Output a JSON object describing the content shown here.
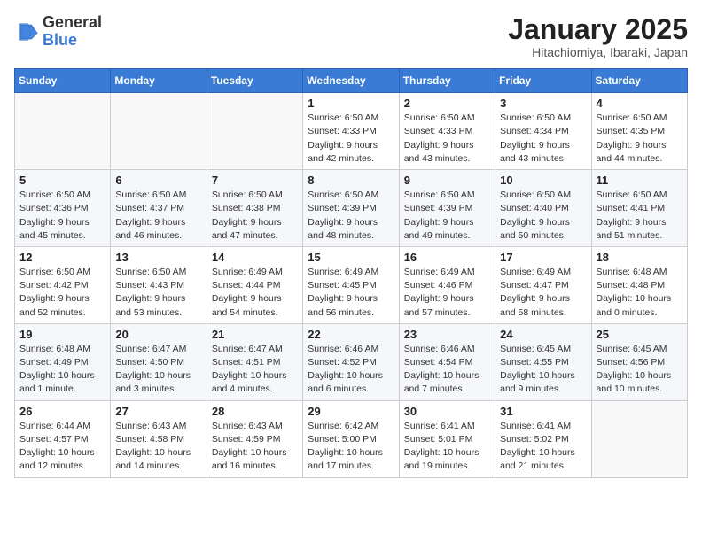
{
  "header": {
    "logo_general": "General",
    "logo_blue": "Blue",
    "month_year": "January 2025",
    "location": "Hitachiomiya, Ibaraki, Japan"
  },
  "days_of_week": [
    "Sunday",
    "Monday",
    "Tuesday",
    "Wednesday",
    "Thursday",
    "Friday",
    "Saturday"
  ],
  "weeks": [
    [
      {
        "day": "",
        "info": ""
      },
      {
        "day": "",
        "info": ""
      },
      {
        "day": "",
        "info": ""
      },
      {
        "day": "1",
        "info": "Sunrise: 6:50 AM\nSunset: 4:33 PM\nDaylight: 9 hours\nand 42 minutes."
      },
      {
        "day": "2",
        "info": "Sunrise: 6:50 AM\nSunset: 4:33 PM\nDaylight: 9 hours\nand 43 minutes."
      },
      {
        "day": "3",
        "info": "Sunrise: 6:50 AM\nSunset: 4:34 PM\nDaylight: 9 hours\nand 43 minutes."
      },
      {
        "day": "4",
        "info": "Sunrise: 6:50 AM\nSunset: 4:35 PM\nDaylight: 9 hours\nand 44 minutes."
      }
    ],
    [
      {
        "day": "5",
        "info": "Sunrise: 6:50 AM\nSunset: 4:36 PM\nDaylight: 9 hours\nand 45 minutes."
      },
      {
        "day": "6",
        "info": "Sunrise: 6:50 AM\nSunset: 4:37 PM\nDaylight: 9 hours\nand 46 minutes."
      },
      {
        "day": "7",
        "info": "Sunrise: 6:50 AM\nSunset: 4:38 PM\nDaylight: 9 hours\nand 47 minutes."
      },
      {
        "day": "8",
        "info": "Sunrise: 6:50 AM\nSunset: 4:39 PM\nDaylight: 9 hours\nand 48 minutes."
      },
      {
        "day": "9",
        "info": "Sunrise: 6:50 AM\nSunset: 4:39 PM\nDaylight: 9 hours\nand 49 minutes."
      },
      {
        "day": "10",
        "info": "Sunrise: 6:50 AM\nSunset: 4:40 PM\nDaylight: 9 hours\nand 50 minutes."
      },
      {
        "day": "11",
        "info": "Sunrise: 6:50 AM\nSunset: 4:41 PM\nDaylight: 9 hours\nand 51 minutes."
      }
    ],
    [
      {
        "day": "12",
        "info": "Sunrise: 6:50 AM\nSunset: 4:42 PM\nDaylight: 9 hours\nand 52 minutes."
      },
      {
        "day": "13",
        "info": "Sunrise: 6:50 AM\nSunset: 4:43 PM\nDaylight: 9 hours\nand 53 minutes."
      },
      {
        "day": "14",
        "info": "Sunrise: 6:49 AM\nSunset: 4:44 PM\nDaylight: 9 hours\nand 54 minutes."
      },
      {
        "day": "15",
        "info": "Sunrise: 6:49 AM\nSunset: 4:45 PM\nDaylight: 9 hours\nand 56 minutes."
      },
      {
        "day": "16",
        "info": "Sunrise: 6:49 AM\nSunset: 4:46 PM\nDaylight: 9 hours\nand 57 minutes."
      },
      {
        "day": "17",
        "info": "Sunrise: 6:49 AM\nSunset: 4:47 PM\nDaylight: 9 hours\nand 58 minutes."
      },
      {
        "day": "18",
        "info": "Sunrise: 6:48 AM\nSunset: 4:48 PM\nDaylight: 10 hours\nand 0 minutes."
      }
    ],
    [
      {
        "day": "19",
        "info": "Sunrise: 6:48 AM\nSunset: 4:49 PM\nDaylight: 10 hours\nand 1 minute."
      },
      {
        "day": "20",
        "info": "Sunrise: 6:47 AM\nSunset: 4:50 PM\nDaylight: 10 hours\nand 3 minutes."
      },
      {
        "day": "21",
        "info": "Sunrise: 6:47 AM\nSunset: 4:51 PM\nDaylight: 10 hours\nand 4 minutes."
      },
      {
        "day": "22",
        "info": "Sunrise: 6:46 AM\nSunset: 4:52 PM\nDaylight: 10 hours\nand 6 minutes."
      },
      {
        "day": "23",
        "info": "Sunrise: 6:46 AM\nSunset: 4:54 PM\nDaylight: 10 hours\nand 7 minutes."
      },
      {
        "day": "24",
        "info": "Sunrise: 6:45 AM\nSunset: 4:55 PM\nDaylight: 10 hours\nand 9 minutes."
      },
      {
        "day": "25",
        "info": "Sunrise: 6:45 AM\nSunset: 4:56 PM\nDaylight: 10 hours\nand 10 minutes."
      }
    ],
    [
      {
        "day": "26",
        "info": "Sunrise: 6:44 AM\nSunset: 4:57 PM\nDaylight: 10 hours\nand 12 minutes."
      },
      {
        "day": "27",
        "info": "Sunrise: 6:43 AM\nSunset: 4:58 PM\nDaylight: 10 hours\nand 14 minutes."
      },
      {
        "day": "28",
        "info": "Sunrise: 6:43 AM\nSunset: 4:59 PM\nDaylight: 10 hours\nand 16 minutes."
      },
      {
        "day": "29",
        "info": "Sunrise: 6:42 AM\nSunset: 5:00 PM\nDaylight: 10 hours\nand 17 minutes."
      },
      {
        "day": "30",
        "info": "Sunrise: 6:41 AM\nSunset: 5:01 PM\nDaylight: 10 hours\nand 19 minutes."
      },
      {
        "day": "31",
        "info": "Sunrise: 6:41 AM\nSunset: 5:02 PM\nDaylight: 10 hours\nand 21 minutes."
      },
      {
        "day": "",
        "info": ""
      }
    ]
  ]
}
